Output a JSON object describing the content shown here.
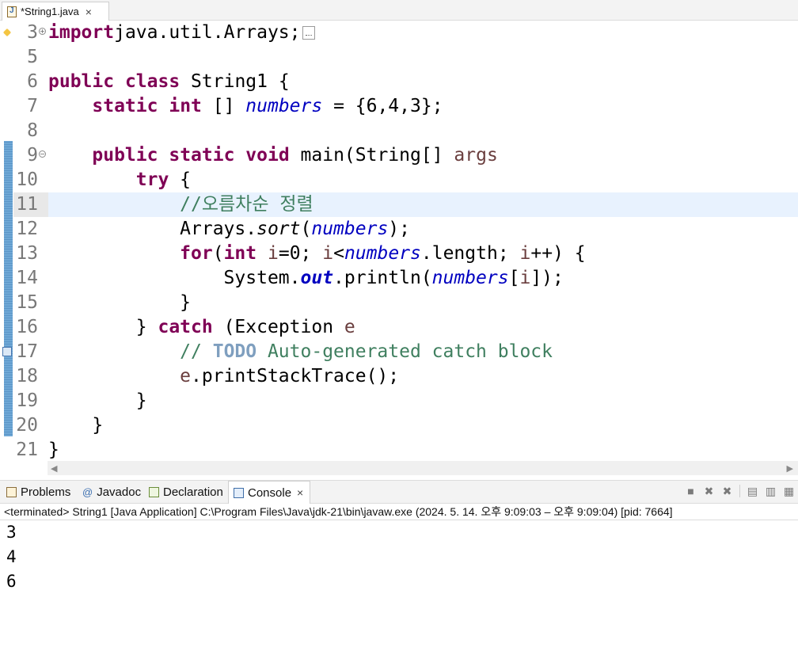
{
  "editor_tab": {
    "label": "*String1.java",
    "close": "×"
  },
  "code": [
    {
      "n": "3",
      "tokens": [
        [
          "kw",
          "import"
        ],
        [
          "",
          "java.util.Arrays;"
        ]
      ]
    },
    {
      "n": "5",
      "tokens": []
    },
    {
      "n": "6",
      "tokens": [
        [
          "kw",
          "public"
        ],
        [
          "",
          " "
        ],
        [
          "kw",
          "class"
        ],
        [
          "",
          " String1 {"
        ]
      ]
    },
    {
      "n": "7",
      "tokens": [
        [
          "",
          "    "
        ],
        [
          "kw",
          "static"
        ],
        [
          "",
          " "
        ],
        [
          "kw",
          "int"
        ],
        [
          "",
          " [] "
        ],
        [
          "fld",
          "numbers"
        ],
        [
          "",
          " = {6,4,3};"
        ]
      ]
    },
    {
      "n": "8",
      "tokens": []
    },
    {
      "n": "9",
      "tokens": [
        [
          "",
          "    "
        ],
        [
          "kw",
          "public"
        ],
        [
          "",
          " "
        ],
        [
          "kw",
          "static"
        ],
        [
          "",
          " "
        ],
        [
          "kw",
          "void"
        ],
        [
          "",
          " main(String[] "
        ],
        [
          "var",
          "args"
        ],
        [
          ") {"
        ]
      ]
    },
    {
      "n": "10",
      "tokens": [
        [
          "",
          "        "
        ],
        [
          "kw",
          "try"
        ],
        [
          "",
          " {"
        ]
      ]
    },
    {
      "n": "11",
      "tokens": [
        [
          "",
          "            "
        ],
        [
          "cm",
          "//오름차순 정렬"
        ]
      ]
    },
    {
      "n": "12",
      "tokens": [
        [
          "",
          "            Arrays."
        ],
        [
          "meth-it",
          "sort"
        ],
        [
          "",
          "("
        ],
        [
          "fld",
          "numbers"
        ],
        [
          "",
          ");"
        ]
      ]
    },
    {
      "n": "13",
      "tokens": [
        [
          "",
          "            "
        ],
        [
          "kw",
          "for"
        ],
        [
          "",
          "("
        ],
        [
          "kw",
          "int"
        ],
        [
          "",
          " "
        ],
        [
          "var",
          "i"
        ],
        [
          "",
          "=0; "
        ],
        [
          "var",
          "i"
        ],
        [
          "",
          "<"
        ],
        [
          "fld",
          "numbers"
        ],
        [
          "",
          ".length; "
        ],
        [
          "var",
          "i"
        ],
        [
          "",
          "++) {"
        ]
      ]
    },
    {
      "n": "14",
      "tokens": [
        [
          "",
          "                System."
        ],
        [
          "stat",
          "out"
        ],
        [
          "",
          ".println("
        ],
        [
          "fld",
          "numbers"
        ],
        [
          "",
          "["
        ],
        [
          "var",
          "i"
        ],
        [
          "",
          "]);"
        ]
      ]
    },
    {
      "n": "15",
      "tokens": [
        [
          "",
          "            }"
        ]
      ]
    },
    {
      "n": "16",
      "tokens": [
        [
          "",
          "        } "
        ],
        [
          "kw",
          "catch"
        ],
        [
          "",
          " (Exception "
        ],
        [
          "var",
          "e"
        ],
        [
          ") {"
        ]
      ]
    },
    {
      "n": "17",
      "tokens": [
        [
          "",
          "            "
        ],
        [
          "cm",
          "// "
        ],
        [
          "todo",
          "TODO"
        ],
        [
          "cm",
          " Auto-generated catch block"
        ]
      ]
    },
    {
      "n": "18",
      "tokens": [
        [
          "",
          "            "
        ],
        [
          "var",
          "e"
        ],
        [
          "",
          ".printStackTrace();"
        ]
      ]
    },
    {
      "n": "19",
      "tokens": [
        [
          "",
          "        }"
        ]
      ]
    },
    {
      "n": "20",
      "tokens": [
        [
          "",
          "    }"
        ]
      ]
    },
    {
      "n": "21",
      "tokens": [
        [
          "",
          "}"
        ]
      ]
    }
  ],
  "panel_tabs": {
    "problems": "Problems",
    "javadoc": "Javadoc",
    "declaration": "Declaration",
    "console": "Console",
    "close": "×"
  },
  "console": {
    "status": "<terminated> String1 [Java Application] C:\\Program Files\\Java\\jdk-21\\bin\\javaw.exe  (2024. 5. 14. 오후 9:09:03 – 오후 9:09:04) [pid: 7664]",
    "output": [
      "3",
      "4",
      "6"
    ]
  },
  "colors": {
    "keyword": "#7f0055",
    "field": "#0000c0",
    "comment": "#3f7f5f",
    "current_line": "#e8f2fe"
  }
}
